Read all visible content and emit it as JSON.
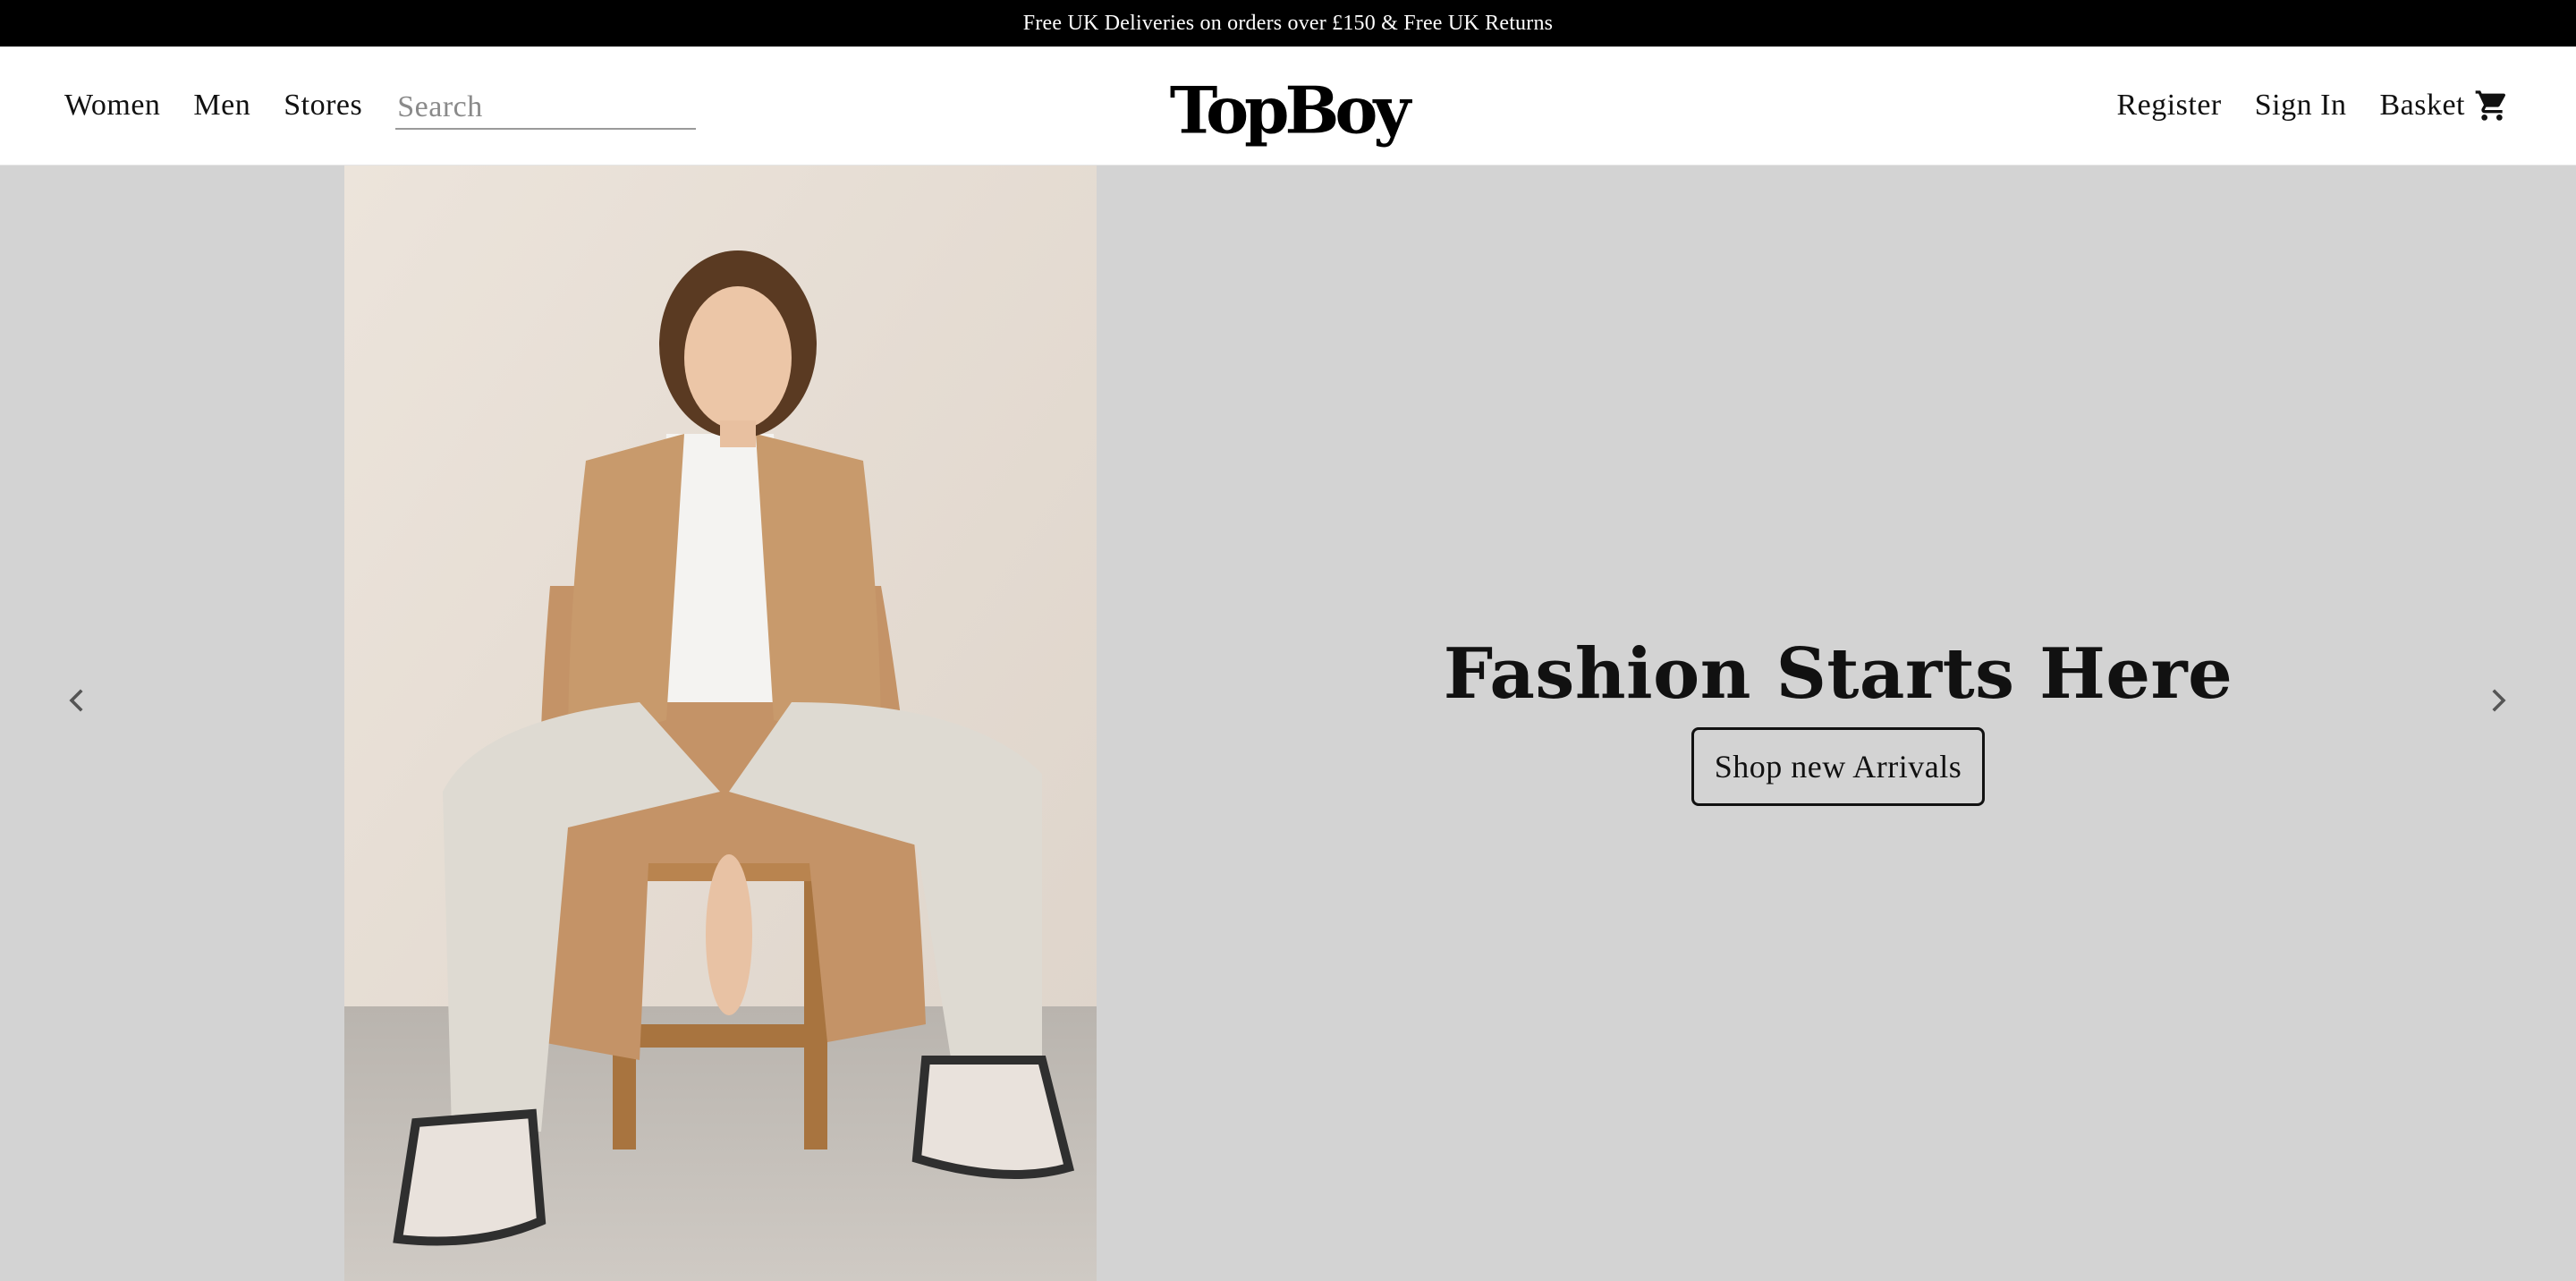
{
  "announcement": {
    "text": "Free UK Deliveries on orders over £150 & Free UK Returns"
  },
  "header": {
    "nav_left": [
      "Women",
      "Men",
      "Stores"
    ],
    "search": {
      "placeholder": "Search",
      "value": ""
    },
    "logo": "TopBoy",
    "nav_right": [
      "Register",
      "Sign In"
    ],
    "basket": {
      "label": "Basket",
      "icon": "cart-icon"
    }
  },
  "hero": {
    "headline": "Fashion Starts Here",
    "cta_label": "Shop new Arrivals",
    "image": {
      "subject": "model-photo"
    },
    "prev_icon": "chevron-left-icon",
    "next_icon": "chevron-right-icon"
  },
  "colors": {
    "announcement_bg": "#000000",
    "header_bg": "#ffffff",
    "hero_bg": "#d3d3d3",
    "text": "#111111"
  }
}
